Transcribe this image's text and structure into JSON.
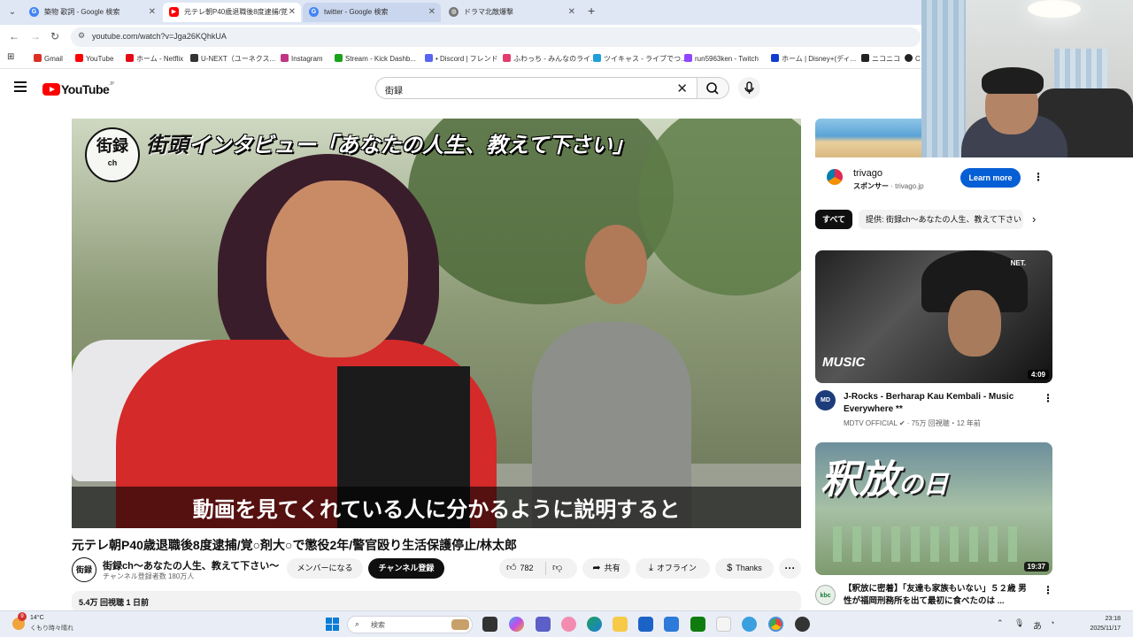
{
  "browser": {
    "tabs": [
      {
        "title": "築物 歌詞 - Google 検索",
        "favicon": "google-g",
        "color": "#4285f4"
      },
      {
        "title": "元テレ朝P40歳退職後8度逮捕/覚",
        "favicon": "youtube",
        "color": "#ff0000"
      },
      {
        "title": "twitter - Google 検索",
        "favicon": "google-g",
        "color": "#4285f4"
      },
      {
        "title": "ドラマ北敵爆撃",
        "favicon": "globe",
        "color": "#777777"
      }
    ],
    "url": "youtube.com/watch?v=Jga26KQhkUA",
    "bookmarks": [
      {
        "label": "Gmail",
        "color": "#d93025"
      },
      {
        "label": "YouTube",
        "color": "#ff0000"
      },
      {
        "label": "ホーム - Netflix",
        "color": "#e50914"
      },
      {
        "label": "U-NEXT（ユーネクス...",
        "color": "#333333"
      },
      {
        "label": "Instagram",
        "color": "#c13584"
      },
      {
        "label": "Stream - Kick Dashb...",
        "color": "#1aa31a"
      },
      {
        "label": "• Discord | フレンド",
        "color": "#5865f2"
      },
      {
        "label": "ふわっち - みんなのライ...",
        "color": "#e33d6b"
      },
      {
        "label": "ツイキャス - ライブでつ...",
        "color": "#1e9fd8"
      },
      {
        "label": "run5963ken - Twitch",
        "color": "#9146ff"
      },
      {
        "label": "ホーム | Disney+(ディ...",
        "color": "#113ccf"
      },
      {
        "label": "ニコニコ",
        "color": "#222222"
      },
      {
        "label": "C",
        "color": "#222222"
      }
    ]
  },
  "youtube": {
    "logo_text": "YouTube",
    "logo_region": "JP",
    "search_query": "街録",
    "video": {
      "overlay_channel_logo": "街録",
      "overlay_channel_logo_sub": "ch",
      "overlay_headline_a": "街頭",
      "overlay_headline_b": "インタビュー「あなたの人生、教えて下さい」",
      "subtitle": "動画を見てくれている人に分かるように説明すると",
      "title": "元テレ朝P40歳退職後8度逮捕/覚○剤大○で懲役2年/警官殴り生活保護停止/林太郎",
      "channel_name": "街録ch〜あなたの人生、教えて下さい〜",
      "channel_subs": "チャンネル登録者数 180万人",
      "channel_avatar_text": "街録",
      "member_label": "メンバーになる",
      "subscribe_label": "チャンネル登録",
      "likes": "782",
      "share_label": "共有",
      "offline_label": "オフライン",
      "thanks_label": "Thanks",
      "views_date": "5.4万 回視聴  1 日前"
    },
    "ad": {
      "name": "trivago",
      "sponsor_label": "スポンサー",
      "domain": "trivago.jp",
      "cta": "Learn more"
    },
    "chips": {
      "selected": "すべて",
      "other": "提供: 街録ch〜あなたの人生、教えて下さい"
    },
    "recommendations": [
      {
        "title": "J-Rocks - Berharap Kau Kembali - Music Everywhere **",
        "channel": "MDTV OFFICIAL",
        "meta": "75万 回視聴・12 年前",
        "duration": "4:09",
        "thumb_text": "MUSIC",
        "thumb_brand": "NET.",
        "avatar_text": "MD"
      },
      {
        "title": "【釈放に密着】「友達も家族もいない」５２歳 男性が福岡刑務所を出て最初に食べたのは ...",
        "duration": "19:37",
        "thumb_text": "釈放",
        "thumb_text_small": "の日",
        "avatar_text": "kbc"
      }
    ]
  },
  "taskbar": {
    "weather_temp": "14°C",
    "weather_desc": "くもり時々晴れ",
    "notification_count": "9",
    "search_placeholder": "検索",
    "ime_label": "あ",
    "time": "23:18",
    "date": "2025/11/17"
  }
}
